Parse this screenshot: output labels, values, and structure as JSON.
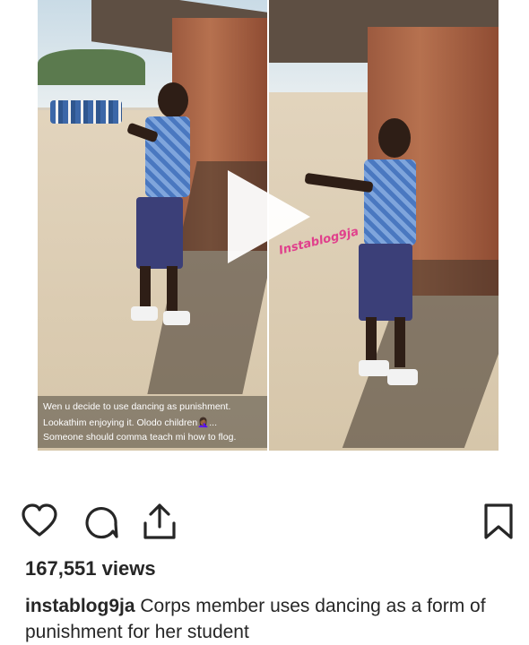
{
  "post": {
    "overlay_caption": [
      "Wen u decide to use dancing as punishment.",
      "Lookathim enjoying it. Olodo children🤦🏾‍♀️...",
      "Someone should comma teach mi how to flog."
    ],
    "watermark": "Instablog9ja",
    "video_state": "paused"
  },
  "actions": {
    "like_icon": "heart-icon",
    "comment_icon": "comment-icon",
    "share_icon": "share-icon",
    "save_icon": "bookmark-icon"
  },
  "stats": {
    "views": "167,551 views"
  },
  "caption": {
    "username": "instablog9ja",
    "text": " Corps member uses dancing as a form of punishment for her student"
  },
  "colors": {
    "text": "#262626",
    "watermark": "#e0408c",
    "background": "#ffffff"
  }
}
